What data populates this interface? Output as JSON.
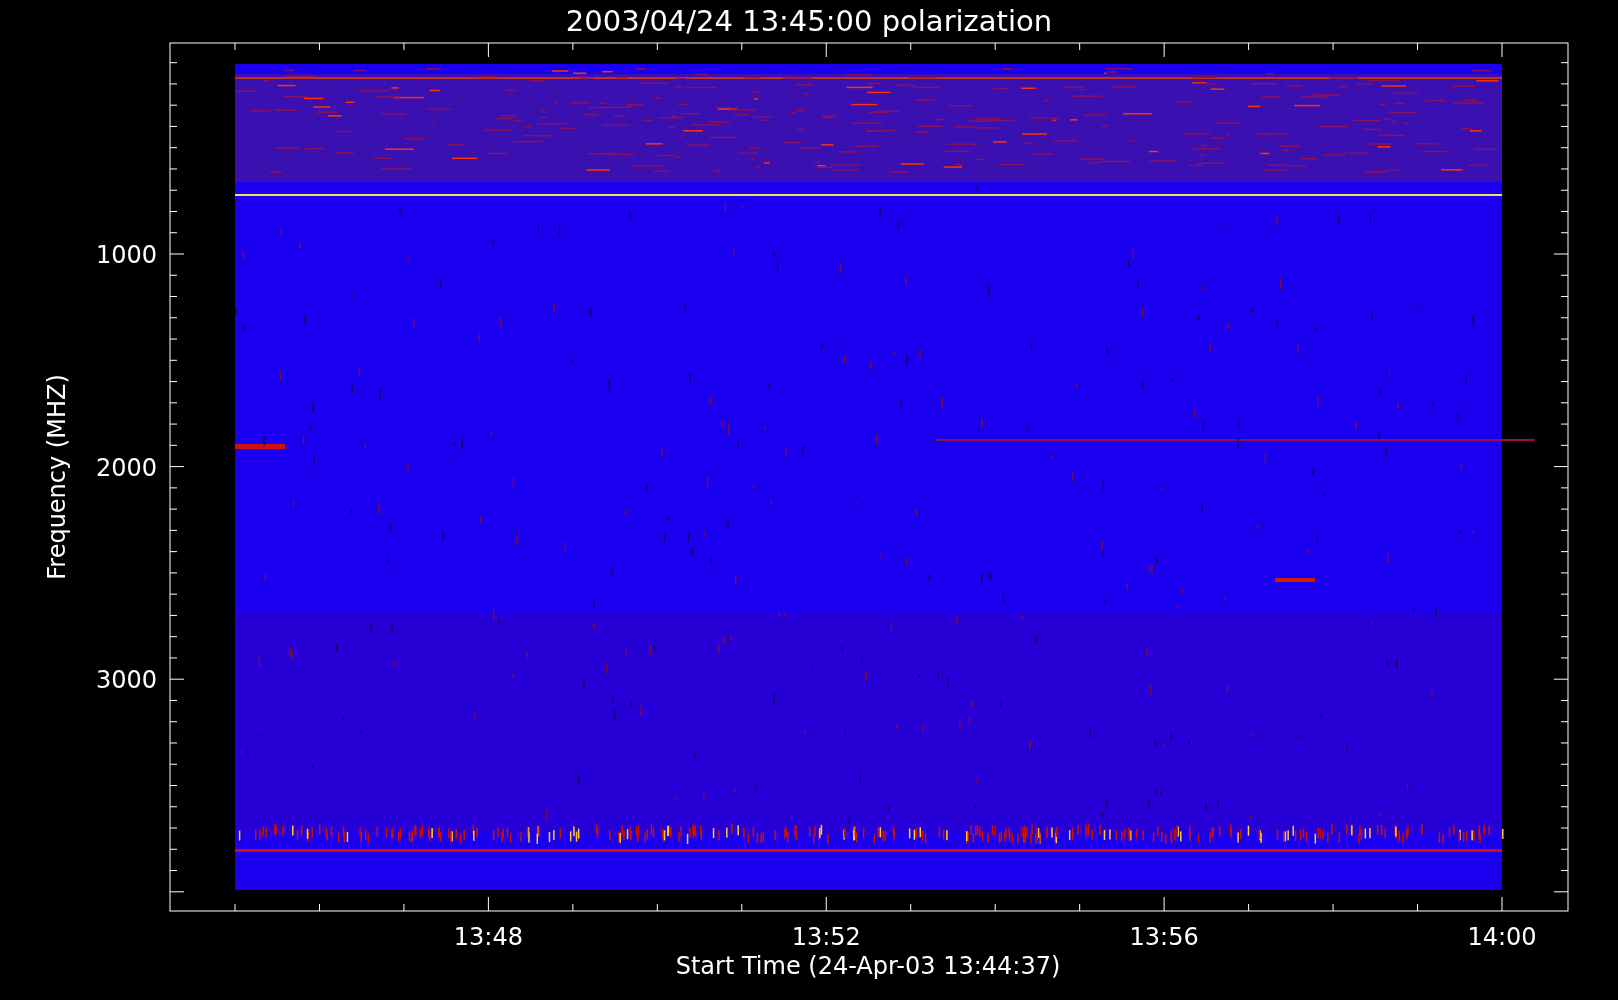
{
  "title": "2003/04/24 13:45:00 polarization",
  "x_axis": {
    "label": "Start Time (24-Apr-03 13:44:37)",
    "ticks": [
      "13:48",
      "13:52",
      "13:56",
      "14:00"
    ]
  },
  "y_axis": {
    "label": "Frequency (MHZ)",
    "ticks": [
      "1000",
      "2000",
      "3000"
    ]
  }
}
